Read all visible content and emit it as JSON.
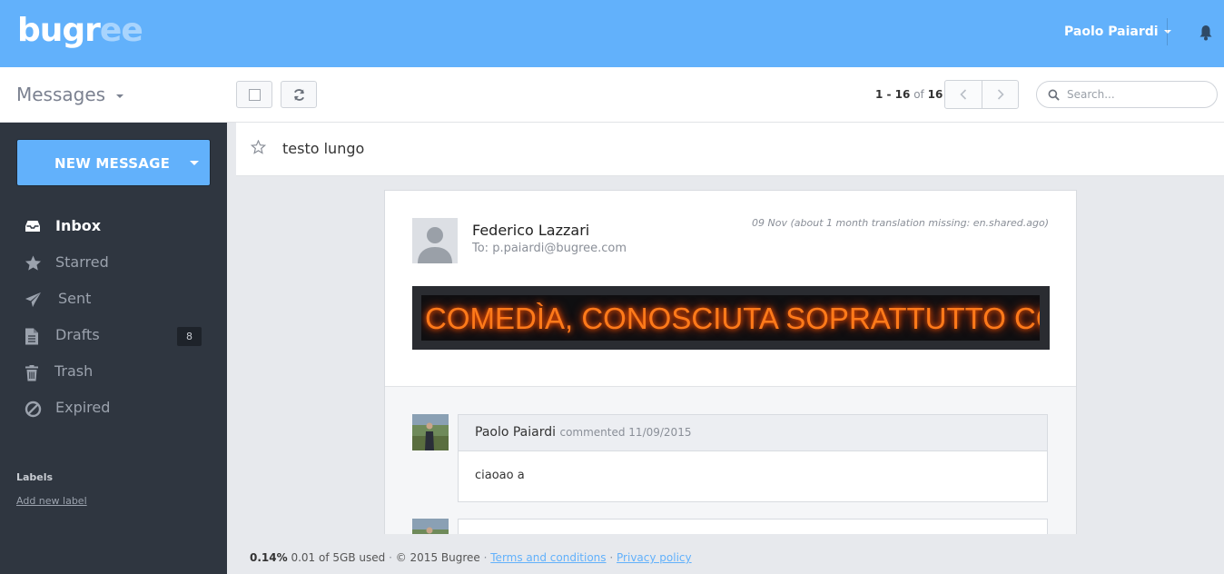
{
  "brand": {
    "logo": "bugr",
    "logo_fade": "ee"
  },
  "user": {
    "name": "Paolo Paiardi"
  },
  "toolbar": {
    "section_title": "Messages",
    "pager": {
      "range": "1 - 16",
      "of": "of",
      "total": "16"
    },
    "search_placeholder": "Search..."
  },
  "sidebar": {
    "new_message_label": "NEW MESSAGE",
    "items": [
      {
        "label": "Inbox",
        "icon": "inbox-icon",
        "active": true
      },
      {
        "label": "Starred",
        "icon": "star-icon"
      },
      {
        "label": "Sent",
        "icon": "paper-plane-icon"
      },
      {
        "label": "Drafts",
        "icon": "document-icon",
        "badge": "8"
      },
      {
        "label": "Trash",
        "icon": "trash-icon"
      },
      {
        "label": "Expired",
        "icon": "ban-icon"
      }
    ],
    "labels_heading": "Labels",
    "add_label": "Add new label"
  },
  "message": {
    "subject": "testo lungo",
    "sender": "Federico Lazzari",
    "recipient": "To: p.paiardi@bugree.com",
    "date": "09 Nov (about 1 month translation missing: en.shared.ago)",
    "banner_text": "COMEDÌA, CONOSCIUTA SOPRATTUTTO COME"
  },
  "comments": [
    {
      "author": "Paolo Paiardi",
      "meta": "commented 11/09/2015",
      "body": "ciaoao a"
    },
    {
      "author": "",
      "meta": "",
      "body": ""
    }
  ],
  "footer": {
    "usage_percent": "0.14%",
    "usage_text": "0.01 of 5GB used",
    "copyright": "© 2015 Bugree",
    "terms": "Terms and conditions",
    "privacy": "Privacy policy",
    "separator": "·"
  },
  "colors": {
    "accent": "#62b1fb",
    "sidebar": "#2f3640"
  }
}
